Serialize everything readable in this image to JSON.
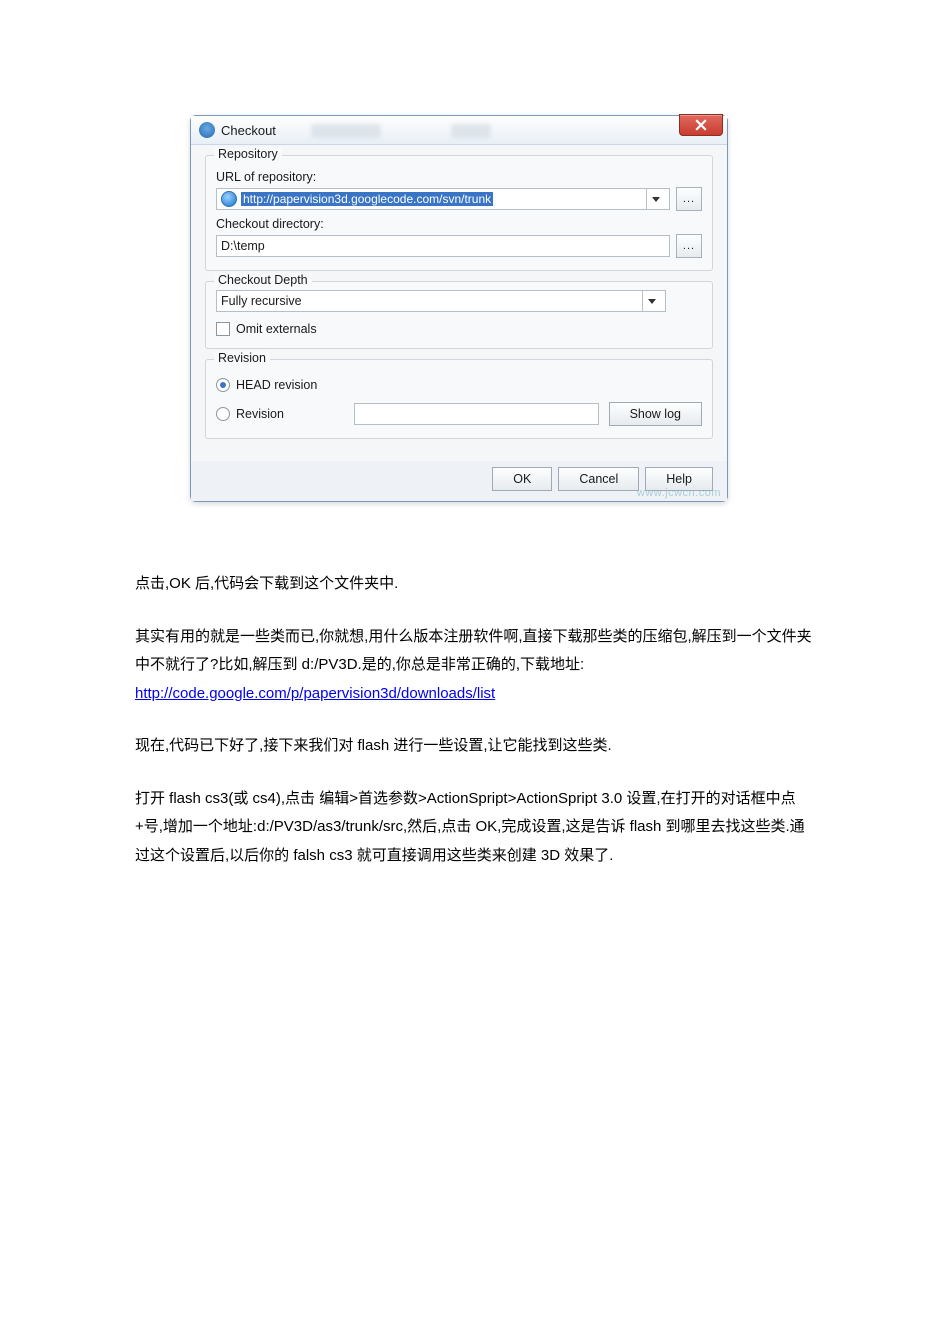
{
  "dialog": {
    "title": "Checkout",
    "repository": {
      "group_label": "Repository",
      "url_label": "URL of repository:",
      "url_value": "http://papervision3d.googlecode.com/svn/trunk",
      "dir_label": "Checkout directory:",
      "dir_value": "D:\\temp",
      "browse": "..."
    },
    "depth": {
      "group_label": "Checkout Depth",
      "value": "Fully recursive",
      "omit_label": "Omit externals"
    },
    "revision": {
      "group_label": "Revision",
      "head_label": "HEAD revision",
      "rev_label": "Revision",
      "showlog": "Show log"
    },
    "buttons": {
      "ok": "OK",
      "cancel": "Cancel",
      "help": "Help"
    },
    "watermark": "www.jcwcn.com"
  },
  "text": {
    "p1": "点击,OK 后,代码会下载到这个文件夹中.",
    "p2a": "其实有用的就是一些类而已,你就想,用什么版本注册软件啊,直接下载那些类的压缩包,解压到一个文件夹中不就行了?比如,解压到 d:/PV3D.是的,你总是非常正确的,下载地址:",
    "link": "http://code.google.com/p/papervision3d/downloads/list",
    "p3": "现在,代码已下好了,接下来我们对 flash 进行一些设置,让它能找到这些类.",
    "p4": "打开 flash cs3(或 cs4),点击 编辑>首选参数>ActionSpript>ActionSpript 3.0 设置,在打开的对话框中点+号,增加一个地址:d:/PV3D/as3/trunk/src,然后,点击 OK,完成设置,这是告诉 flash 到哪里去找这些类.通过这个设置后,以后你的 falsh cs3 就可直接调用这些类来创建 3D 效果了."
  }
}
